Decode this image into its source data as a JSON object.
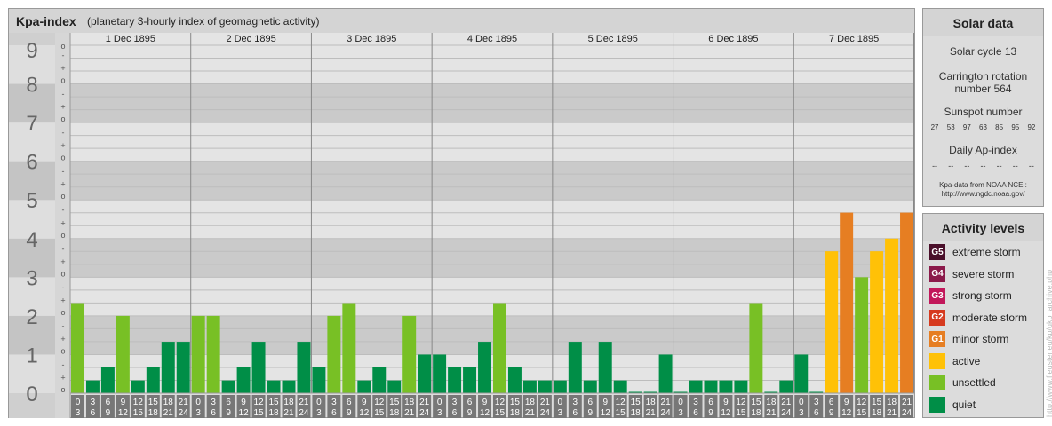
{
  "header": {
    "title": "Kpa-index",
    "subtitle": "(planetary 3-hourly index of geomagnetic activity)"
  },
  "chart_data": {
    "type": "bar",
    "title": "Kpa-index",
    "subtitle": "(planetary 3-hourly index of geomagnetic activity)",
    "ylim": [
      0,
      9
    ],
    "y_ticks": [
      "0",
      "1",
      "2",
      "3",
      "4",
      "5",
      "6",
      "7",
      "8",
      "9"
    ],
    "sub_ticks": [
      "o",
      "+",
      "-"
    ],
    "days": [
      "1 Dec 1895",
      "2 Dec 1895",
      "3 Dec 1895",
      "4 Dec 1895",
      "5 Dec 1895",
      "6 Dec 1895",
      "7 Dec 1895"
    ],
    "interval_start": [
      "0",
      "3",
      "6",
      "9",
      "12",
      "15",
      "18",
      "21"
    ],
    "interval_end": [
      "3",
      "6",
      "9",
      "12",
      "15",
      "18",
      "21",
      "24"
    ],
    "values": [
      [
        2.33,
        0.33,
        0.67,
        2.0,
        0.33,
        0.67,
        1.33,
        1.33
      ],
      [
        2.0,
        2.0,
        0.33,
        0.67,
        1.33,
        0.33,
        0.33,
        1.33
      ],
      [
        0.67,
        2.0,
        2.33,
        0.33,
        0.67,
        0.33,
        2.0,
        1.0
      ],
      [
        1.0,
        0.67,
        0.67,
        1.33,
        2.33,
        0.67,
        0.33,
        0.33
      ],
      [
        0.33,
        1.33,
        0.33,
        1.33,
        0.33,
        0,
        0,
        1.0
      ],
      [
        0,
        0.33,
        0.33,
        0.33,
        0.33,
        2.33,
        0,
        0.33
      ],
      [
        1.0,
        0,
        3.67,
        4.67,
        3.0,
        3.67,
        4.0,
        4.67
      ]
    ],
    "colors": {
      "quiet": "#008e47",
      "unsettled": "#78c025",
      "active": "#ffc107",
      "minor": "#e67e22",
      "moderate": "#d63a1f",
      "strong": "#c2185b",
      "severe": "#8b1a4a",
      "extreme": "#4a0f2a"
    },
    "grid": true
  },
  "solar": {
    "title": "Solar data",
    "cycle": "Solar cycle 13",
    "rotation_line1": "Carrington rotation",
    "rotation_line2": "number 564",
    "sunspot_label": "Sunspot number",
    "sunspots": [
      "27",
      "53",
      "97",
      "63",
      "85",
      "95",
      "92"
    ],
    "ap_label": "Daily Ap-index",
    "ap_values": [
      "--",
      "--",
      "--",
      "--",
      "--",
      "--",
      "--"
    ],
    "credit_line1": "Kpa-data from NOAA NCEI:",
    "credit_line2": "http://www.ngdc.noaa.gov/"
  },
  "legend": {
    "title": "Activity levels",
    "items": [
      {
        "badge": "G5",
        "label": "extreme storm",
        "color": "#4a0f2a"
      },
      {
        "badge": "G4",
        "label": "severe storm",
        "color": "#8b1a4a"
      },
      {
        "badge": "G3",
        "label": "strong storm",
        "color": "#c2185b"
      },
      {
        "badge": "G2",
        "label": "moderate storm",
        "color": "#d63a1f"
      },
      {
        "badge": "G1",
        "label": "minor storm",
        "color": "#e67e22"
      },
      {
        "badge": "",
        "label": "active",
        "color": "#ffc107"
      },
      {
        "badge": "",
        "label": "unsettled",
        "color": "#78c025"
      },
      {
        "badge": "",
        "label": "quiet",
        "color": "#008e47"
      }
    ]
  },
  "watermark": "http://www.fleuster.eu/kp/gkp_archive.php"
}
